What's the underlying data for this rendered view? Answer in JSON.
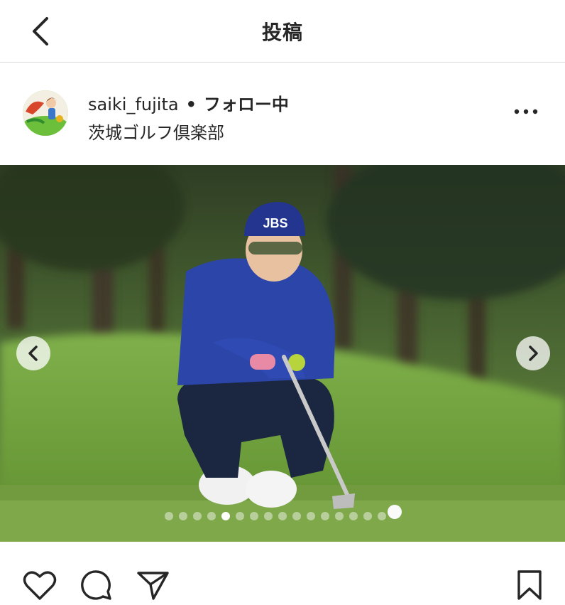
{
  "header": {
    "title": "投稿",
    "back_icon": "chevron-left-icon"
  },
  "post": {
    "username": "saiki_fujita",
    "separator": "•",
    "follow_status": "フォロー中",
    "location": "茨城ゴルフ倶楽部",
    "more_icon": "more-horizontal-icon"
  },
  "media": {
    "cap_text": "JBS",
    "slide_count": 16,
    "active_slide": 5,
    "prev_icon": "chevron-left-icon",
    "next_icon": "chevron-right-icon"
  },
  "actions": {
    "like_icon": "heart-icon",
    "comment_icon": "comment-icon",
    "share_icon": "paper-plane-icon",
    "save_icon": "bookmark-icon"
  }
}
